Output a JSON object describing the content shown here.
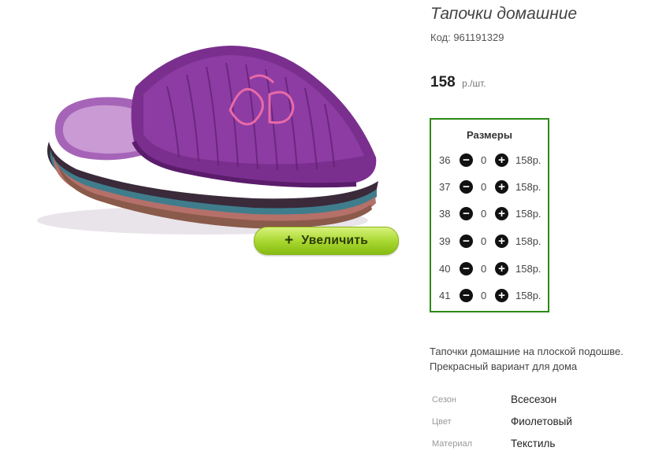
{
  "product": {
    "title": "Тапочки домашние",
    "code": "Код: 961191329",
    "price": "158",
    "price_unit": "р./шт."
  },
  "zoom_button": {
    "icon": "plus-icon",
    "label": "Увеличить"
  },
  "sizes": {
    "title": "Размеры",
    "rows": [
      {
        "size": "36",
        "qty": "0",
        "price": "158р."
      },
      {
        "size": "37",
        "qty": "0",
        "price": "158р."
      },
      {
        "size": "38",
        "qty": "0",
        "price": "158р."
      },
      {
        "size": "39",
        "qty": "0",
        "price": "158р."
      },
      {
        "size": "40",
        "qty": "0",
        "price": "158р."
      },
      {
        "size": "41",
        "qty": "0",
        "price": "158р."
      }
    ]
  },
  "description": "Тапочки домашние на плоской подошве. Прекрасный вариант для дома",
  "attributes": [
    {
      "key": "Сезон",
      "value": "Всесезон"
    },
    {
      "key": "Цвет",
      "value": "Фиолетовый"
    },
    {
      "key": "Материал",
      "value": "Текстиль"
    }
  ],
  "colors": {
    "accent_green": "#2b8a14",
    "button_green": "#a6d62d",
    "slipper_purple": "#7a2f8e"
  }
}
